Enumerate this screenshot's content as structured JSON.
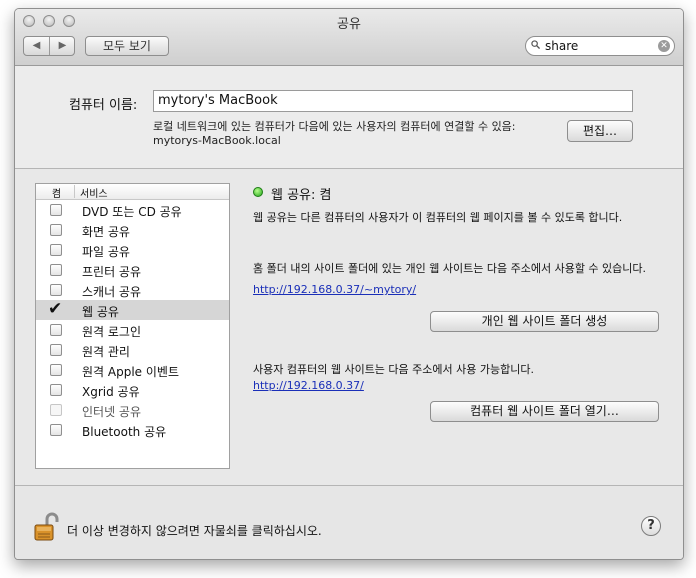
{
  "window": {
    "title": "공유"
  },
  "toolbar": {
    "back_icon": "◀",
    "forward_icon": "▶",
    "show_all_label": "모두 보기",
    "search_value": "share",
    "search_clear_icon": "✕"
  },
  "computer_name": {
    "label": "컴퓨터 이름:",
    "value": "mytory's MacBook",
    "desc_line1": "로컬 네트워크에 있는 컴퓨터가 다음에 있는 사용자의 컴퓨터에 연결할 수 있음:",
    "desc_line2": "mytorys-MacBook.local",
    "edit_label": "편집…"
  },
  "services": {
    "header_on": "켬",
    "header_service": "서비스",
    "items": [
      {
        "label": "DVD 또는 CD 공유",
        "checked": false,
        "enabled": true
      },
      {
        "label": "화면 공유",
        "checked": false,
        "enabled": true
      },
      {
        "label": "파일 공유",
        "checked": false,
        "enabled": true
      },
      {
        "label": "프린터 공유",
        "checked": false,
        "enabled": true
      },
      {
        "label": "스캐너 공유",
        "checked": false,
        "enabled": true
      },
      {
        "label": "웹 공유",
        "checked": true,
        "enabled": true,
        "selected": true
      },
      {
        "label": "원격 로그인",
        "checked": false,
        "enabled": true
      },
      {
        "label": "원격 관리",
        "checked": false,
        "enabled": true
      },
      {
        "label": "원격 Apple 이벤트",
        "checked": false,
        "enabled": true
      },
      {
        "label": "Xgrid 공유",
        "checked": false,
        "enabled": true
      },
      {
        "label": "인터넷 공유",
        "checked": false,
        "enabled": false
      },
      {
        "label": "Bluetooth 공유",
        "checked": false,
        "enabled": true
      }
    ],
    "checkmark": "✔"
  },
  "detail": {
    "status_title": "웹 공유: 켬",
    "status_color": "#2ecc2e",
    "description": "웹 공유는 다른 컴퓨터의 사용자가 이 컴퓨터의 웹 페이지를 볼 수 있도록 합니다.",
    "personal_text": "홈 폴더 내의 사이트 폴더에 있는 개인 웹 사이트는 다음 주소에서 사용할 수 있습니다.",
    "personal_url": "http://192.168.0.37/~mytory/",
    "personal_button": "개인 웹 사이트 폴더 생성",
    "computer_text": "사용자 컴퓨터의 웹 사이트는 다음 주소에서 사용 가능합니다.",
    "computer_url": "http://192.168.0.37/",
    "computer_button": "컴퓨터 웹 사이트 폴더 열기…"
  },
  "footer": {
    "lock_icon": "unlocked-padlock-icon",
    "lock_text": "더 이상 변경하지 않으려면 자물쇠를 클릭하십시오.",
    "help_label": "?"
  }
}
